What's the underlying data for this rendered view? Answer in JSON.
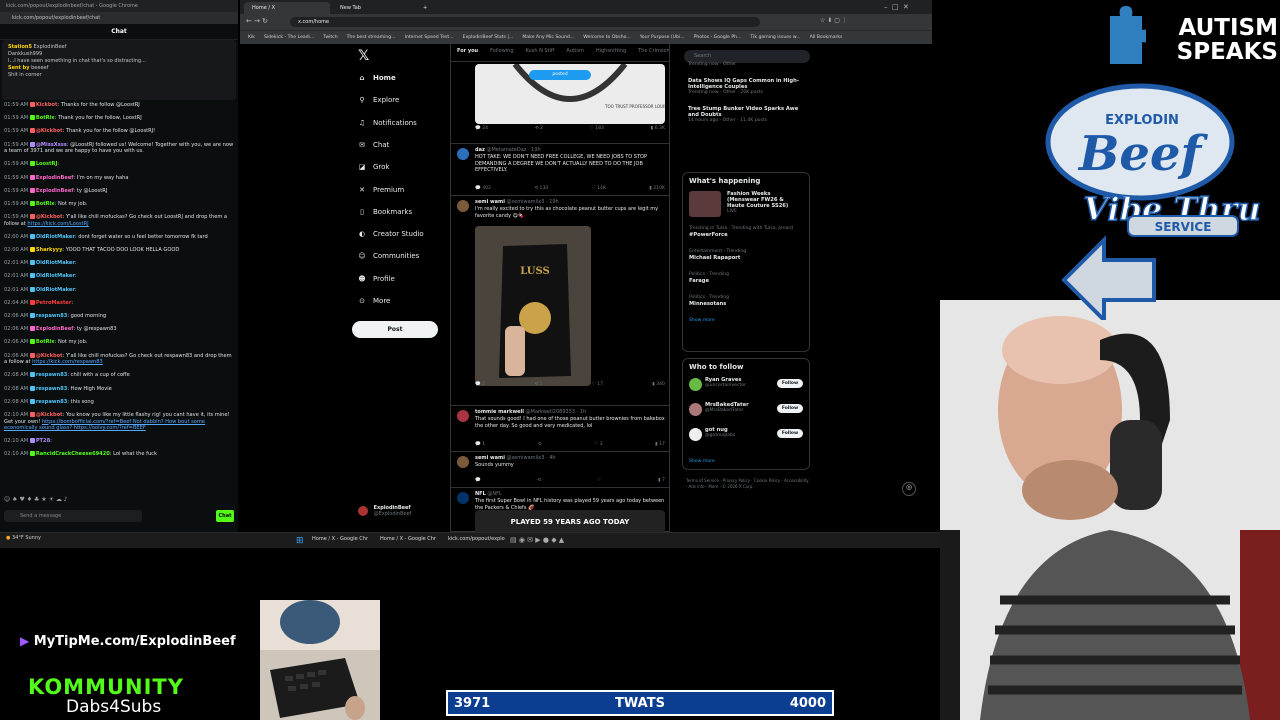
{
  "chat_window": {
    "title": "kick.com/popout/explodinbeef/chat - Google Chrome",
    "url": "kick.com/popout/explodinbeef/chat",
    "header": "Chat",
    "pinned": [
      {
        "name": "Station5",
        "text": "ExplodinBeef"
      },
      {
        "name": "",
        "text": "Dankkush999"
      },
      {
        "name": "",
        "text": "I...I have seen something in chat that's so distracting..."
      },
      {
        "name": "Sent by",
        "text": "beeeef"
      },
      {
        "name": "",
        "text": "Shit in corner"
      }
    ],
    "messages": [
      {
        "time": "01:59 AM",
        "user": "Kickbot",
        "color": "#ff5e5e",
        "text": "Thanks for the follow @LoostRJ"
      },
      {
        "time": "01:59 AM",
        "user": "BotRix",
        "color": "#53fc18",
        "text": "Thank you for the follow, LoostRJ"
      },
      {
        "time": "01:59 AM",
        "user": "@Kickbot",
        "color": "#ff5e5e",
        "text": "Thank you for the follow @LoostRJ!"
      },
      {
        "time": "01:59 AM",
        "user": "@MissXsss",
        "color": "#b18cff",
        "text": "@LoostRJ followed us! Welcome! Together with you, we are now a team of 3971 and we are happy to have you with us."
      },
      {
        "time": "01:59 AM",
        "user": "LoostRJ",
        "color": "#53fc18",
        "text": ""
      },
      {
        "time": "01:59 AM",
        "user": "ExplodinBeef",
        "color": "#ff66cc",
        "text": "I'm on my way haha"
      },
      {
        "time": "01:59 AM",
        "user": "ExplodinBeef",
        "color": "#ff66cc",
        "text": "ty @LoostRJ"
      },
      {
        "time": "01:59 AM",
        "user": "BotRix",
        "color": "#53fc18",
        "text": "Not my job."
      },
      {
        "time": "01:59 AM",
        "user": "@Kickbot",
        "color": "#ff5e5e",
        "text": "Y'all like chill mofuckas? Go check out LoostRJ and drop them a follow at",
        "link": "https://kick.com/LoostRJ"
      },
      {
        "time": "02:00 AM",
        "user": "OldRiotMaker",
        "color": "#4fc3f7",
        "text": "dont forget water so u feel better tomorrow fk tard"
      },
      {
        "time": "02:00 AM",
        "user": "Sharkyyy",
        "color": "#ffd700",
        "text": "YOOO THAT TACOO DOO LOOK HELLA GOOD"
      },
      {
        "time": "02:01 AM",
        "user": "OldRiotMaker",
        "color": "#4fc3f7",
        "text": ""
      },
      {
        "time": "02:01 AM",
        "user": "OldRiotMaker",
        "color": "#4fc3f7",
        "text": ""
      },
      {
        "time": "02:01 AM",
        "user": "OldRiotMaker",
        "color": "#4fc3f7",
        "text": ""
      },
      {
        "time": "02:04 AM",
        "user": "PetroMaster",
        "color": "#ff3b3b",
        "text": ""
      },
      {
        "time": "02:06 AM",
        "user": "respawn83",
        "color": "#4fc3f7",
        "text": "good morning"
      },
      {
        "time": "02:06 AM",
        "user": "ExplodinBeef",
        "color": "#ff66cc",
        "text": "ty @respawn83"
      },
      {
        "time": "02:06 AM",
        "user": "BotRix",
        "color": "#53fc18",
        "text": "Not my job."
      },
      {
        "time": "02:06 AM",
        "user": "@Kickbot",
        "color": "#ff5e5e",
        "text": "Y'all like chill mofuckas? Go check out respawn83 and drop them a follow at",
        "link": "https://kick.com/respawn83"
      },
      {
        "time": "02:08 AM",
        "user": "respawn83",
        "color": "#4fc3f7",
        "text": "chill with a cup of coffe"
      },
      {
        "time": "02:08 AM",
        "user": "respawn83",
        "color": "#4fc3f7",
        "text": "How High Movie"
      },
      {
        "time": "02:08 AM",
        "user": "respawn83",
        "color": "#4fc3f7",
        "text": "this song"
      },
      {
        "time": "02:10 AM",
        "user": "@Kickbot",
        "color": "#ff5e5e",
        "text": "You know you like my little flashy rig! you cant have it, its mine! Get your own!",
        "link": "https://bombofficial.com/?ref=Beef Not dabbin? How bout some economically sound glass? https://ooivy.com/?ref=BEEF"
      },
      {
        "time": "02:10 AM",
        "user": "PT28",
        "color": "#b18cff",
        "text": ""
      },
      {
        "time": "02:10 AM",
        "user": "RancidCrackCheese69420",
        "color": "#53fc18",
        "text": "Lol what the fuck"
      }
    ],
    "input_placeholder": "Send a message",
    "send_label": "Chat"
  },
  "x_window": {
    "tabs": [
      "Home / X",
      "New Tab"
    ],
    "url": "x.com/home",
    "bookmarks": [
      "Kik",
      "Sidekick - The Leadi...",
      "Twitch",
      "The best streaming...",
      "Internet Speed Test...",
      "ExplodinBeef Stats |...",
      "Make Any Mic Sound...",
      "Welcome to Obsho...",
      "Your Purpose (Ubi...",
      "Photos - Google Ph...",
      "Tik gaming issues w...",
      "All Bookmarks"
    ],
    "nav": [
      {
        "label": "Home",
        "icon": "home-icon",
        "glyph": "⌂"
      },
      {
        "label": "Explore",
        "icon": "search-icon",
        "glyph": "⚲"
      },
      {
        "label": "Notifications",
        "icon": "bell-icon",
        "glyph": "♫"
      },
      {
        "label": "Chat",
        "icon": "chat-icon",
        "glyph": "✉"
      },
      {
        "label": "Grok",
        "icon": "grok-icon",
        "glyph": "◪"
      },
      {
        "label": "Premium",
        "icon": "x-icon",
        "glyph": "✕"
      },
      {
        "label": "Bookmarks",
        "icon": "bookmark-icon",
        "glyph": "▯"
      },
      {
        "label": "Creator Studio",
        "icon": "studio-icon",
        "glyph": "◐"
      },
      {
        "label": "Communities",
        "icon": "people-icon",
        "glyph": "☺"
      },
      {
        "label": "Profile",
        "icon": "person-icon",
        "glyph": "☻"
      },
      {
        "label": "More",
        "icon": "more-icon",
        "glyph": "⊙"
      }
    ],
    "post_label": "Post",
    "profile_name": "ExplodinBeef",
    "profile_handle": "@ExplodinBeef",
    "feed_tabs": [
      "For you",
      "Following",
      "Kush N Stiff",
      "Autism",
      "Highsnitting",
      "The Crimson Cre..."
    ],
    "posted_pill": "posted",
    "tweets": [
      {
        "name": "",
        "handle": "",
        "text": "TOO TRUST PROFESSOR LOUIS ARNIE",
        "actions": [
          "24",
          "2",
          "183",
          "6.3K"
        ]
      },
      {
        "name": "daz",
        "handle": "@MetamateDaz · 19h",
        "text": "HOT TAKE: WE DON'T NEED FREE COLLEGE, WE NEED JOBS TO STOP DEMANDING A DEGREE WE DON'T ACTUALLY NEED TO DO THE JOB EFFECTIVELY.",
        "actions": [
          "402",
          "130",
          "14K",
          "210K"
        ]
      },
      {
        "name": "semi wami",
        "handle": "@semiwamilx3 · 19h",
        "text": "I'm really excited to try this as chocolate peanut butter cups are legit my favorite candy 😋🍫",
        "actions": [
          "2",
          "1",
          "17",
          "340"
        ]
      },
      {
        "name": "tommie markwell",
        "handle": "@Markwell2089333 · 1h",
        "text": "That sounds good! I had one of those peanut butter brownies from bakebox the other day. So good and very medicated, lol",
        "actions": [
          "1",
          "",
          "3",
          "17"
        ]
      },
      {
        "name": "semi wami",
        "handle": "@semiwamilx3 · 4h",
        "text": "Sounds yummy",
        "actions": [
          "",
          "",
          "",
          "7"
        ]
      },
      {
        "name": "NFL",
        "handle": "@NFL",
        "text": "The first Super Bowl in NFL history was played 59 years ago today between the Packers & Chiefs 🏈",
        "actions": [
          "",
          "",
          "",
          ""
        ]
      }
    ],
    "nfl_image_text": "PLAYED 59 YEARS AGO TODAY",
    "search_placeholder": "Search",
    "top_trends": [
      {
        "title": "",
        "meta": "Trending now · Other"
      },
      {
        "title": "Data Shows IQ Gaps Common in High-Intelligence Couples",
        "meta": "Trending now · Other · 20K posts"
      },
      {
        "title": "Tree Stump Bunker Video Sparks Awe and Doubts",
        "meta": "14 hours ago · Other · 11.4K posts"
      }
    ],
    "happening_title": "What's happening",
    "happening": [
      {
        "title": "Fashion Weeks (Menswear FW26 & Haute Couture SS26)",
        "meta": "LIVE"
      },
      {
        "title": "#PowerForce",
        "meta": "Trending in Tulsa · Trending with Tulsa, Jenard"
      },
      {
        "title": "Michael Rapaport",
        "meta": "Entertainment · Trending"
      },
      {
        "title": "Farage",
        "meta": "Politics · Trending"
      },
      {
        "title": "Minnesotans",
        "meta": "Politics · Trending"
      }
    ],
    "show_more": "Show more",
    "who_to_follow_title": "Who to follow",
    "who_to_follow": [
      {
        "name": "Ryan Graves",
        "handle": "@uncertainvector"
      },
      {
        "name": "MrsBakedTater",
        "handle": "@MrsBakedTater"
      },
      {
        "name": "got nug",
        "handle": "@gotnuglabs"
      }
    ],
    "follow_label": "Follow",
    "footer": "Terms of Service · Privacy Policy · Cookie Policy · Accessibility · Ads info · More · © 2026 X Corp."
  },
  "taskbar": {
    "weather_temp": "34°F",
    "weather_desc": "Sunny",
    "tasks": [
      "Home / X - Google Chr",
      "Home / X - Google Chr",
      "kick.com/popout/explo"
    ]
  },
  "overlays": {
    "autism_line1": "AUTISM",
    "autism_line2": "SPEAKS",
    "logo_top": "EXPLODIN",
    "logo_beef": "Beef",
    "logo_vibe": "Vibe Thru",
    "logo_service": "SERVICE",
    "tipme": "MyTipMe.com/ExplodinBeef",
    "kommunity": "KOMMUNITY",
    "dabs": "Dabs4Subs"
  },
  "goal_bar": {
    "current": "3971",
    "label": "TWATS",
    "target": "4000",
    "progress_fraction": 0.9925
  },
  "colors": {
    "kick_green": "#53fc18",
    "x_blue": "#1d9bf0",
    "goal_blue": "#0b3d91",
    "autism_blue": "#2f7fc1"
  }
}
